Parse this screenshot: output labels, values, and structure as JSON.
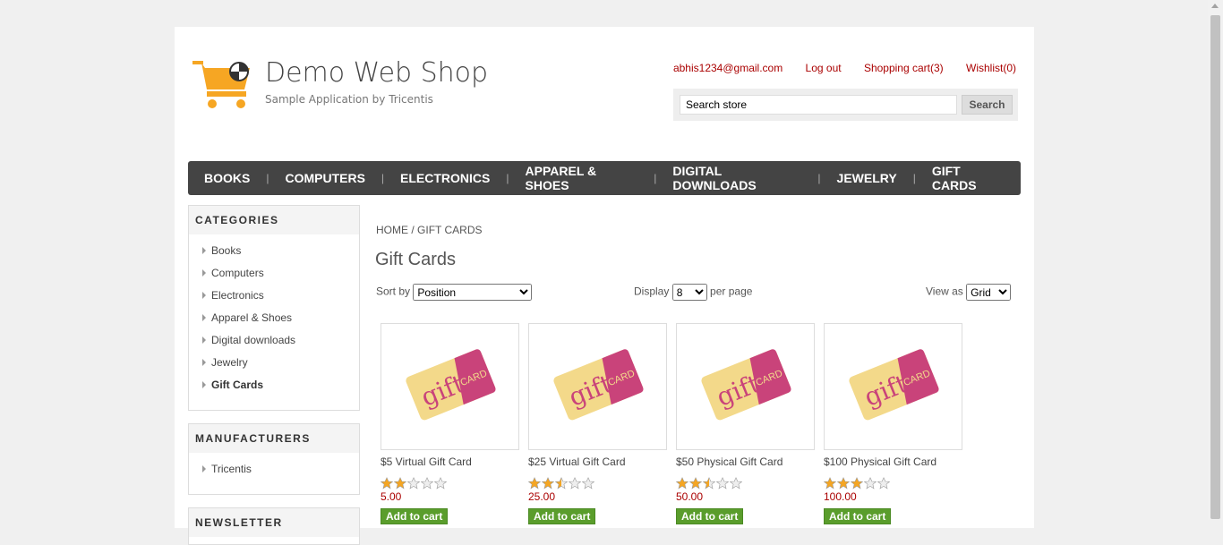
{
  "header": {
    "title": "Demo Web Shop",
    "subtitle": "Sample Application by Tricentis",
    "links": [
      "abhis1234@gmail.com",
      "Log out",
      "Shopping cart(3)",
      "Wishlist(0)"
    ],
    "search_placeholder": "Search store",
    "search_button": "Search"
  },
  "nav": [
    "BOOKS",
    "COMPUTERS",
    "ELECTRONICS",
    "APPAREL & SHOES",
    "DIGITAL DOWNLOADS",
    "JEWELRY",
    "GIFT CARDS"
  ],
  "categories": {
    "title": "CATEGORIES",
    "items": [
      "Books",
      "Computers",
      "Electronics",
      "Apparel & Shoes",
      "Digital downloads",
      "Jewelry",
      "Gift Cards"
    ],
    "active": "Gift Cards"
  },
  "manufacturers": {
    "title": "MANUFACTURERS",
    "items": [
      "Tricentis"
    ]
  },
  "newsletter": {
    "title": "NEWSLETTER"
  },
  "breadcrumb": {
    "home": "HOME",
    "sep": "/",
    "current": "GIFT CARDS"
  },
  "page_title": "Gift Cards",
  "controls": {
    "sort_label": "Sort by",
    "sort_value": "Position",
    "display_label": "Display",
    "display_value": "8",
    "per_page": "per page",
    "view_label": "View as",
    "view_value": "Grid"
  },
  "products": [
    {
      "name": "$5 Virtual Gift Card",
      "rating": 2,
      "price": "5.00",
      "button": "Add to cart"
    },
    {
      "name": "$25 Virtual Gift Card",
      "rating": 2.5,
      "price": "25.00",
      "button": "Add to cart"
    },
    {
      "name": "$50 Physical Gift Card",
      "rating": 2.5,
      "price": "50.00",
      "button": "Add to cart"
    },
    {
      "name": "$100 Physical Gift Card",
      "rating": 3,
      "price": "100.00",
      "button": "Add to cart"
    }
  ],
  "image_text": {
    "gift": "gift",
    "card": "CARD"
  },
  "colors": {
    "link": "#aa0000",
    "nav_bg": "#444444",
    "button_green": "#5a9d2c",
    "star": "#f5a623"
  }
}
